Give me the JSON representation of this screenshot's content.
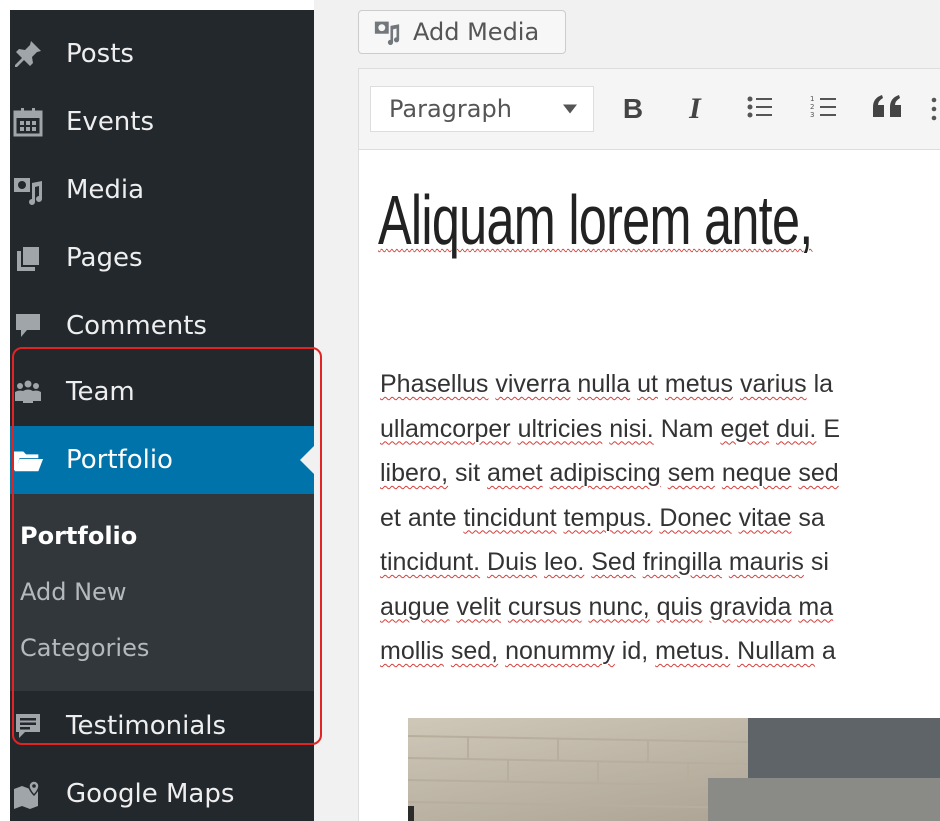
{
  "sidebar": {
    "items": [
      {
        "label": "Posts",
        "icon": "pushpin-icon"
      },
      {
        "label": "Events",
        "icon": "calendar-icon"
      },
      {
        "label": "Media",
        "icon": "media-icon"
      },
      {
        "label": "Pages",
        "icon": "pages-icon"
      },
      {
        "label": "Comments",
        "icon": "comment-icon"
      },
      {
        "label": "Team",
        "icon": "team-icon"
      },
      {
        "label": "Portfolio",
        "icon": "folder-icon",
        "active": true
      },
      {
        "label": "Testimonials",
        "icon": "testimonial-icon"
      },
      {
        "label": "Google Maps",
        "icon": "map-icon"
      }
    ],
    "submenu": [
      {
        "label": "Portfolio",
        "current": true
      },
      {
        "label": "Add New"
      },
      {
        "label": "Categories"
      }
    ],
    "colors": {
      "background": "#23282d",
      "active": "#0073aa",
      "submenu": "#32373c",
      "highlight": "#e02424"
    }
  },
  "editor": {
    "add_media_label": "Add Media",
    "format_select": "Paragraph",
    "toolbar": {
      "bold": "B",
      "italic": "I",
      "quote": "66"
    },
    "post_title": "Aliquam lorem ante,",
    "body_lines": [
      "Phasellus viverra nulla ut metus varius la",
      "ullamcorper ultricies nisi. Nam eget dui. E",
      "libero, sit amet adipiscing sem neque sed",
      "et ante tincidunt tempus. Donec vitae sa",
      "tincidunt. Duis leo. Sed fringilla mauris si",
      "augue velit cursus nunc, quis gravida ma",
      "mollis sed, nonummy id, metus. Nullam a"
    ]
  }
}
